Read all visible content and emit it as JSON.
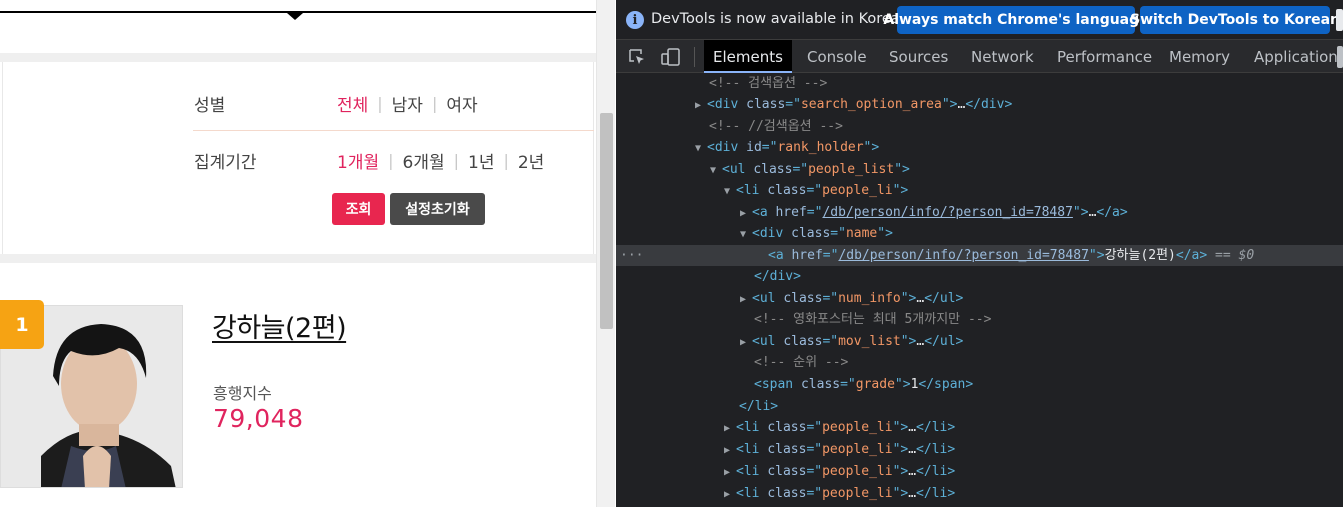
{
  "page": {
    "options": {
      "gender_label": "성별",
      "gender_items": [
        "전체",
        "남자",
        "여자"
      ],
      "period_label": "집계기간",
      "period_items": [
        "1개월",
        "6개월",
        "1년",
        "2년"
      ],
      "search_button": "조회",
      "reset_button": "설정초기화"
    },
    "rank": {
      "number": "1",
      "name": "강하늘(2편)",
      "stat_label": "흥행지수",
      "stat_value": "79,048"
    }
  },
  "devtools": {
    "infobar": {
      "text": "DevTools is now available in Korean!",
      "button_always": "Always match Chrome's language",
      "button_switch": "Switch DevTools to Korean"
    },
    "tabs": [
      "Elements",
      "Console",
      "Sources",
      "Network",
      "Performance",
      "Memory",
      "Application"
    ],
    "active_tab": "Elements",
    "dom": {
      "c1": "<!-- 검색옵션 -->",
      "search_option_area": "search_option_area",
      "c2": "<!-- //검색옵션 -->",
      "rank_holder": "rank_holder",
      "people_list": "people_list",
      "people_li": "people_li",
      "href": "/db/person/info/?person_id=78487",
      "name_class": "name",
      "name_text": "강하늘(2편)",
      "selected_marker": "== $0",
      "num_info": "num_info",
      "c3": "<!-- 영화포스터는 최대 5개까지만 -->",
      "mov_list": "mov_list",
      "c4": "<!-- 순위 -->",
      "grade": "grade",
      "grade_value": "1"
    }
  }
}
